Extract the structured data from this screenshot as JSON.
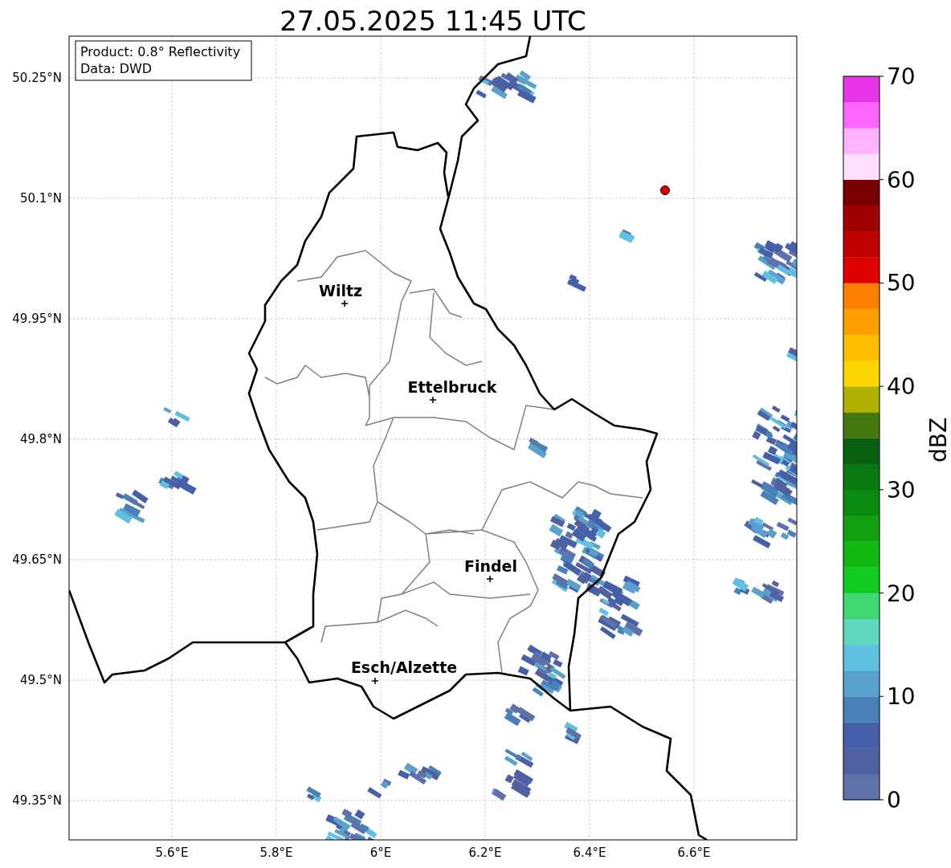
{
  "title": "27.05.2025 11:45 UTC",
  "info_box": [
    "Product: 0.8° Reflectivity",
    "Data: DWD"
  ],
  "lat_labels": [
    "50.25°N",
    "50.1°N",
    "49.95°N",
    "49.8°N",
    "49.65°N",
    "49.5°N",
    "49.35°N"
  ],
  "lon_labels": [
    "5.6°E",
    "5.8°E",
    "6°E",
    "6.2°E",
    "6.4°E",
    "6.6°E"
  ],
  "cities": [
    {
      "name": "Wiltz",
      "kind": "town"
    },
    {
      "name": "Ettelbruck",
      "kind": "town"
    },
    {
      "name": "Findel",
      "kind": "town"
    },
    {
      "name": "Esch/Alzette",
      "kind": "town"
    }
  ],
  "radar_site": {
    "color": "#e00000"
  },
  "colorbar": {
    "label": "dBZ",
    "ticks": [
      "70",
      "60",
      "50",
      "40",
      "30",
      "20",
      "10",
      "0"
    ],
    "bins": [
      {
        "color": "#6070a8"
      },
      {
        "color": "#5060a0"
      },
      {
        "color": "#4560a8"
      },
      {
        "color": "#4a80b8"
      },
      {
        "color": "#5aa0cc"
      },
      {
        "color": "#60c0e0"
      },
      {
        "color": "#60d8c0"
      },
      {
        "color": "#40d870"
      },
      {
        "color": "#10cc20"
      },
      {
        "color": "#10b810"
      },
      {
        "color": "#10a010"
      },
      {
        "color": "#0a8a10"
      },
      {
        "color": "#0a7810"
      },
      {
        "color": "#0a6010"
      },
      {
        "color": "#457810"
      },
      {
        "color": "#b0b000"
      },
      {
        "color": "#ffd700"
      },
      {
        "color": "#ffbf00"
      },
      {
        "color": "#ff9f00"
      },
      {
        "color": "#ff7f00"
      },
      {
        "color": "#e00000"
      },
      {
        "color": "#c00000"
      },
      {
        "color": "#a00000"
      },
      {
        "color": "#7a0000"
      },
      {
        "color": "#ffdfff"
      },
      {
        "color": "#ffb3ff"
      },
      {
        "color": "#ff66ff"
      },
      {
        "color": "#e935e9"
      }
    ]
  }
}
